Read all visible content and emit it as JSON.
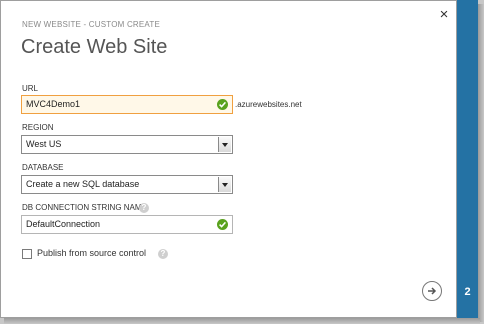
{
  "dialog": {
    "subtitle": "NEW WEBSITE - CUSTOM CREATE",
    "title": "Create Web Site",
    "close_icon": "close-icon",
    "step_number": "2",
    "accent_color": "#2472a4"
  },
  "url": {
    "label": "URL",
    "value": "MVC4Demo1",
    "suffix": ".azurewebsites.net",
    "valid_icon": "check-icon"
  },
  "region": {
    "label": "REGION",
    "selected": "West US"
  },
  "database": {
    "label": "DATABASE",
    "selected": "Create a new SQL database"
  },
  "connection_string": {
    "label": "DB CONNECTION STRING NAME",
    "value": "DefaultConnection",
    "help_icon": "question-icon",
    "valid_icon": "check-icon"
  },
  "publish": {
    "label": "Publish from source control",
    "checked": false,
    "help_icon": "question-icon"
  },
  "next_icon": "arrow-right-icon"
}
